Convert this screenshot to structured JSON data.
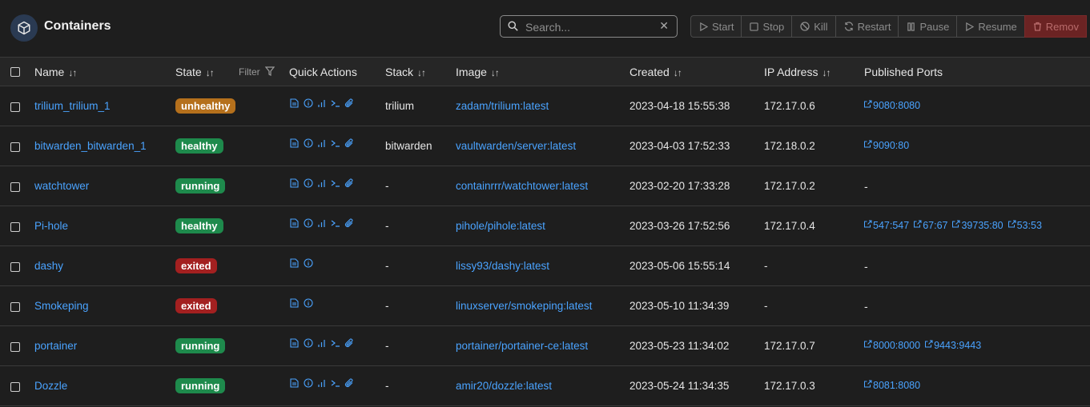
{
  "header": {
    "title": "Containers",
    "icon": "cube-icon"
  },
  "search": {
    "placeholder": "Search...",
    "value": ""
  },
  "toolbar": {
    "start": "Start",
    "stop": "Stop",
    "kill": "Kill",
    "restart": "Restart",
    "pause": "Pause",
    "resume": "Resume",
    "remove": "Remov"
  },
  "table": {
    "columns": {
      "name": "Name",
      "state": "State",
      "filter": "Filter",
      "quick_actions": "Quick Actions",
      "stack": "Stack",
      "image": "Image",
      "created": "Created",
      "ip": "IP Address",
      "ports": "Published Ports"
    },
    "rows": [
      {
        "name": "trilium_trilium_1",
        "state": "unhealthy",
        "actions": [
          "logs",
          "inspect",
          "stats",
          "console",
          "attach"
        ],
        "stack": "trilium",
        "image": "zadam/trilium:latest",
        "created": "2023-04-18 15:55:38",
        "ip": "172.17.0.6",
        "ports": [
          "9080:8080"
        ]
      },
      {
        "name": "bitwarden_bitwarden_1",
        "state": "healthy",
        "actions": [
          "logs",
          "inspect",
          "stats",
          "console",
          "attach"
        ],
        "stack": "bitwarden",
        "image": "vaultwarden/server:latest",
        "created": "2023-04-03 17:52:33",
        "ip": "172.18.0.2",
        "ports": [
          "9090:80"
        ]
      },
      {
        "name": "watchtower",
        "state": "running",
        "actions": [
          "logs",
          "inspect",
          "stats",
          "console",
          "attach"
        ],
        "stack": "-",
        "image": "containrrr/watchtower:latest",
        "created": "2023-02-20 17:33:28",
        "ip": "172.17.0.2",
        "ports_text": "-",
        "ports": []
      },
      {
        "name": "Pi-hole",
        "state": "healthy",
        "actions": [
          "logs",
          "inspect",
          "stats",
          "console",
          "attach"
        ],
        "stack": "-",
        "image": "pihole/pihole:latest",
        "created": "2023-03-26 17:52:56",
        "ip": "172.17.0.4",
        "ports": [
          "547:547",
          "67:67",
          "39735:80",
          "53:53"
        ]
      },
      {
        "name": "dashy",
        "state": "exited",
        "actions": [
          "logs",
          "inspect"
        ],
        "stack": "-",
        "image": "lissy93/dashy:latest",
        "created": "2023-05-06 15:55:14",
        "ip": "-",
        "ports_text": "-",
        "ports": []
      },
      {
        "name": "Smokeping",
        "state": "exited",
        "actions": [
          "logs",
          "inspect"
        ],
        "stack": "-",
        "image": "linuxserver/smokeping:latest",
        "created": "2023-05-10 11:34:39",
        "ip": "-",
        "ports_text": "-",
        "ports": []
      },
      {
        "name": "portainer",
        "state": "running",
        "actions": [
          "logs",
          "inspect",
          "stats",
          "console",
          "attach"
        ],
        "stack": "-",
        "image": "portainer/portainer-ce:latest",
        "created": "2023-05-23 11:34:02",
        "ip": "172.17.0.7",
        "ports": [
          "8000:8000",
          "9443:9443"
        ]
      },
      {
        "name": "Dozzle",
        "state": "running",
        "actions": [
          "logs",
          "inspect",
          "stats",
          "console",
          "attach"
        ],
        "stack": "-",
        "image": "amir20/dozzle:latest",
        "created": "2023-05-24 11:34:35",
        "ip": "172.17.0.3",
        "ports": [
          "8081:8080"
        ]
      }
    ]
  }
}
